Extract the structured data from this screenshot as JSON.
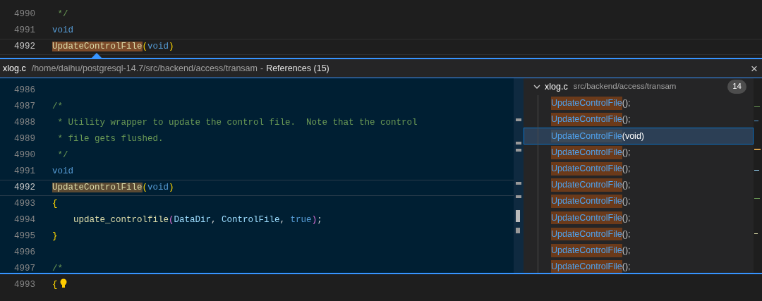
{
  "main_editor": {
    "lines": [
      {
        "number": "4990",
        "current": false,
        "tokens": [
          {
            "text": " */",
            "kind": "comment"
          }
        ]
      },
      {
        "number": "4991",
        "current": false,
        "tokens": [
          {
            "text": "void",
            "kind": "keyword"
          }
        ]
      },
      {
        "number": "4992",
        "current": true,
        "tokens": [
          {
            "text": "UpdateControlFile",
            "kind": "match"
          },
          {
            "text": "(",
            "kind": "bracket"
          },
          {
            "text": "void",
            "kind": "keyword"
          },
          {
            "text": ")",
            "kind": "bracket"
          }
        ]
      }
    ]
  },
  "peek": {
    "file": "xlog.c",
    "path": "/home/daihu/postgresql-14.7/src/backend/access/transam",
    "separator": "-",
    "title": "References (15)",
    "close": "×",
    "code_lines": [
      {
        "number": "4986",
        "current": false
      },
      {
        "number": "4987",
        "current": false,
        "tokens": [
          {
            "text": "/*",
            "kind": "comment"
          }
        ]
      },
      {
        "number": "4988",
        "current": false,
        "tokens": [
          {
            "text": " * Utility wrapper to update the control file.  Note that the control",
            "kind": "comment"
          }
        ]
      },
      {
        "number": "4989",
        "current": false,
        "tokens": [
          {
            "text": " * file gets flushed.",
            "kind": "comment"
          }
        ]
      },
      {
        "number": "4990",
        "current": false,
        "tokens": [
          {
            "text": " */",
            "kind": "comment"
          }
        ]
      },
      {
        "number": "4991",
        "current": false,
        "tokens": [
          {
            "text": "void",
            "kind": "keyword"
          }
        ]
      },
      {
        "number": "4992",
        "current": true,
        "tokens": [
          {
            "text": "UpdateControlFile",
            "kind": "match"
          },
          {
            "text": "(",
            "kind": "bracket"
          },
          {
            "text": "void",
            "kind": "keyword"
          },
          {
            "text": ")",
            "kind": "bracket"
          }
        ]
      },
      {
        "number": "4993",
        "current": false,
        "tokens": [
          {
            "text": "{",
            "kind": "bracket"
          }
        ]
      },
      {
        "number": "4994",
        "current": false,
        "tokens": [
          {
            "text": "    update_controlfile",
            "kind": "function"
          },
          {
            "text": "(",
            "kind": "bracket2"
          },
          {
            "text": "DataDir",
            "kind": "variable"
          },
          {
            "text": ", ",
            "kind": "plain"
          },
          {
            "text": "ControlFile",
            "kind": "variable"
          },
          {
            "text": ", ",
            "kind": "plain"
          },
          {
            "text": "true",
            "kind": "keyword"
          },
          {
            "text": ")",
            "kind": "bracket2"
          },
          {
            "text": ";",
            "kind": "plain"
          }
        ]
      },
      {
        "number": "4995",
        "current": false,
        "tokens": [
          {
            "text": "}",
            "kind": "bracket"
          }
        ]
      },
      {
        "number": "4996",
        "current": false
      },
      {
        "number": "4997",
        "current": false,
        "tokens": [
          {
            "text": "/*",
            "kind": "comment"
          }
        ]
      }
    ],
    "tree": {
      "file": "xlog.c",
      "path": "src/backend/access/transam",
      "count": "14",
      "expanded": true,
      "items": [
        {
          "name": "UpdateControlFile",
          "rest": "();",
          "selected": false
        },
        {
          "name": "UpdateControlFile",
          "rest": "();",
          "selected": false
        },
        {
          "name": "UpdateControlFile",
          "rest": "(void)",
          "selected": true
        },
        {
          "name": "UpdateControlFile",
          "rest": "();",
          "selected": false
        },
        {
          "name": "UpdateControlFile",
          "rest": "();",
          "selected": false
        },
        {
          "name": "UpdateControlFile",
          "rest": "();",
          "selected": false
        },
        {
          "name": "UpdateControlFile",
          "rest": "();",
          "selected": false
        },
        {
          "name": "UpdateControlFile",
          "rest": "();",
          "selected": false
        },
        {
          "name": "UpdateControlFile",
          "rest": "();",
          "selected": false
        },
        {
          "name": "UpdateControlFile",
          "rest": "();",
          "selected": false
        },
        {
          "name": "UpdateControlFile",
          "rest": "();",
          "selected": false
        }
      ]
    }
  },
  "bottom_editor": {
    "lines": [
      {
        "number": "4993",
        "current": false,
        "lightbulb": true,
        "tokens": [
          {
            "text": "{",
            "kind": "bracket"
          }
        ]
      }
    ]
  }
}
